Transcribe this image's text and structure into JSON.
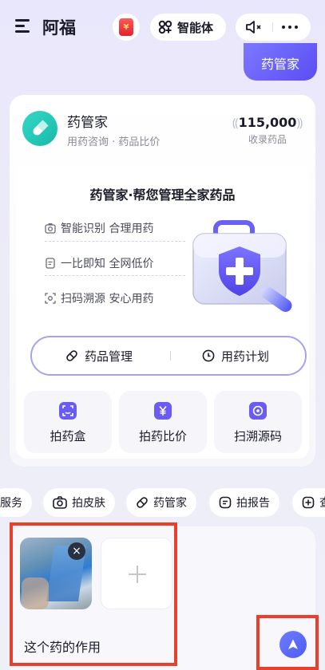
{
  "header": {
    "app_title": "阿福",
    "redpacket_symbol": "¥",
    "agent_label": "智能体",
    "icons": [
      "menu-icon",
      "redpacket-icon",
      "agent-icon",
      "mute-icon",
      "more-icon"
    ]
  },
  "user_message": "药管家",
  "card": {
    "title": "药管家",
    "subtitle": "用药咨询 · 药品比价",
    "stat_value": "115,000",
    "stat_label": "收录药品",
    "panel": {
      "title": "药管家·帮您管理全家药品",
      "features": [
        "智能识别 合理用药",
        "一比即知 全网低价",
        "扫码溯源 安心用药"
      ],
      "segments": [
        "药品管理",
        "用药计划"
      ],
      "quick_actions": [
        "拍药盒",
        "拍药比价",
        "扫溯源码"
      ]
    }
  },
  "chips": [
    "服务",
    "拍皮肤",
    "药管家",
    "拍报告",
    "查"
  ],
  "input": {
    "text": "这个药的作用",
    "close_symbol": "×"
  },
  "colors": {
    "accent": "#5a4df3",
    "teal": "#19b9a8",
    "highlight": "#e8402d"
  }
}
